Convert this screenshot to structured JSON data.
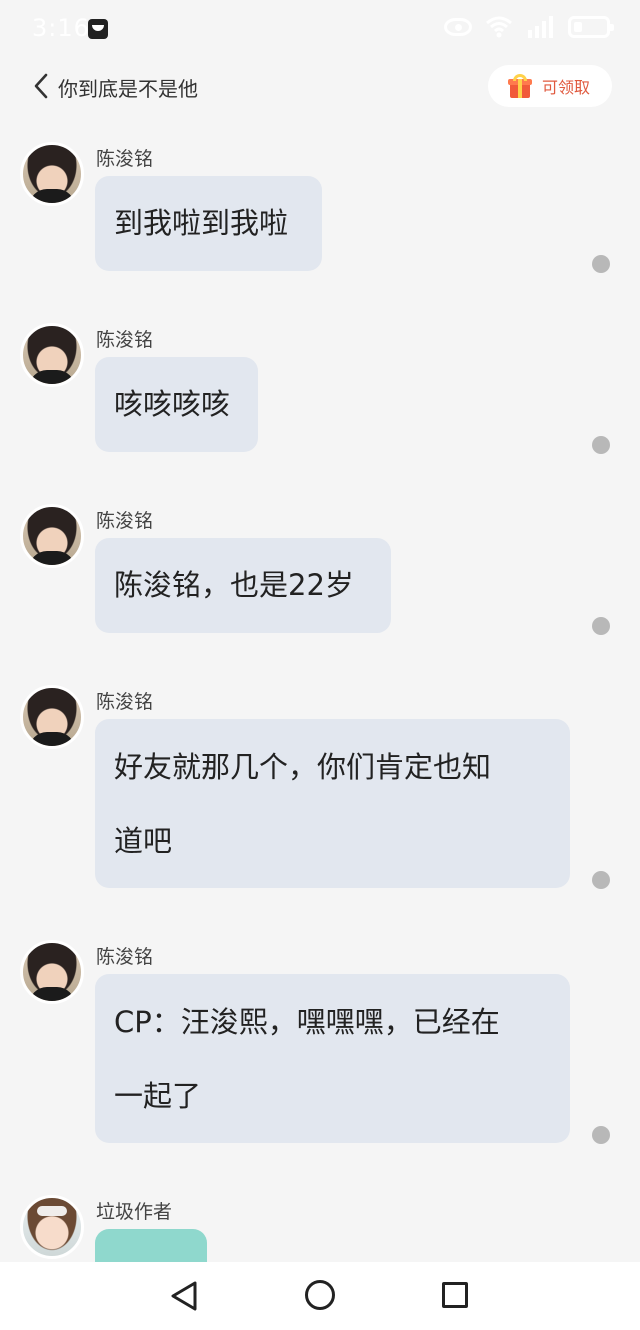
{
  "status_bar": {
    "time": "3:16",
    "icons": [
      "notification-app-icon",
      "eye-icon",
      "wifi-icon",
      "signal-icon",
      "battery-icon"
    ]
  },
  "header": {
    "back_icon": "chevron-left-icon",
    "title": "你到底是不是他",
    "reward_icon": "gift-icon",
    "reward_label": "可领取"
  },
  "messages": [
    {
      "sender": "陈浚铭",
      "avatar": "boy-avatar",
      "lines": [
        "到我啦到我啦"
      ]
    },
    {
      "sender": "陈浚铭",
      "avatar": "boy-avatar",
      "lines": [
        "咳咳咳咳"
      ]
    },
    {
      "sender": "陈浚铭",
      "avatar": "boy-avatar",
      "lines": [
        "陈浚铭，也是22岁"
      ]
    },
    {
      "sender": "陈浚铭",
      "avatar": "boy-avatar",
      "lines": [
        "好友就那几个，你们肯定也知",
        "道吧"
      ]
    },
    {
      "sender": "陈浚铭",
      "avatar": "boy-avatar",
      "lines": [
        "CP：汪浚熙，嘿嘿嘿，已经在",
        "一起了"
      ]
    },
    {
      "sender": "垃圾作者",
      "avatar": "girl-avatar",
      "lines": []
    }
  ],
  "nav_bar": {
    "icons": [
      "back-triangle-icon",
      "home-circle-icon",
      "recent-square-icon"
    ]
  },
  "colors": {
    "background": "#f5f5f5",
    "bubble": "#e2e7ef",
    "teal_bubble": "#8fd8cd",
    "reward_text": "#e05a3f",
    "read_dot": "#b8b8b8"
  }
}
